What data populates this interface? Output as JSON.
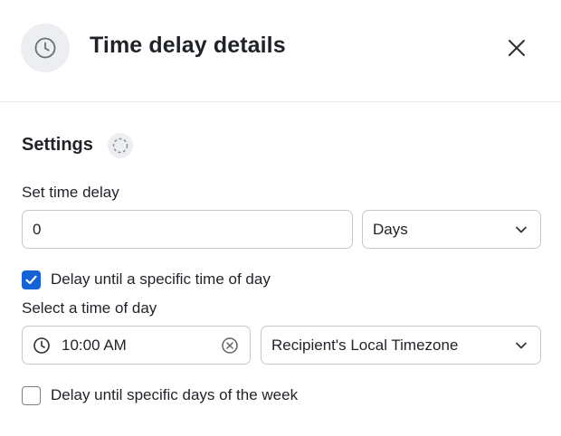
{
  "header": {
    "title": "Time delay details",
    "icon": "clock-icon",
    "close_icon": "close-icon"
  },
  "settings": {
    "title": "Settings",
    "status_icon": "loading-spinner-icon"
  },
  "delay": {
    "label": "Set time delay",
    "value": "0",
    "unit_selected": "Days"
  },
  "time_of_day": {
    "checkbox_label": "Delay until a specific time of day",
    "checked": true,
    "label": "Select a time of day",
    "time_value": "10:00 AM",
    "timezone_selected": "Recipient's Local Timezone"
  },
  "days_of_week": {
    "checkbox_label": "Delay until specific days of the week",
    "checked": false
  },
  "colors": {
    "accent": "#1463d6",
    "border": "#c5c9ce",
    "icon_bg": "#eceef1",
    "text": "#1f2328"
  }
}
